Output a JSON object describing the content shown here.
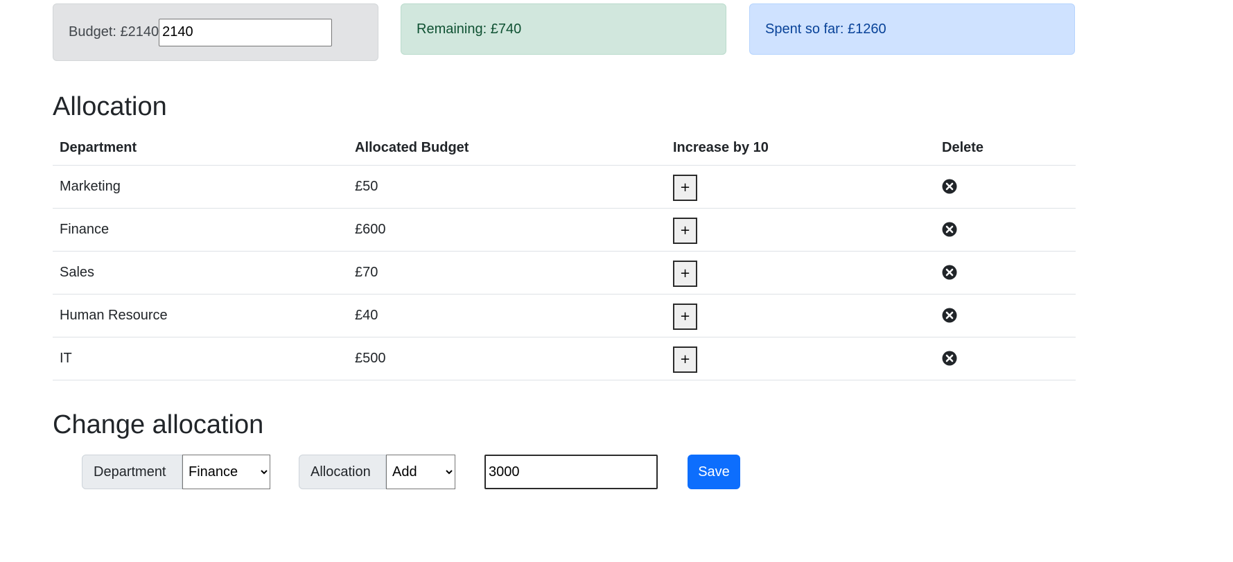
{
  "cards": {
    "budget_label": "Budget: £2140",
    "budget_value": "2140",
    "remaining": "Remaining: £740",
    "spent": "Spent so far: £1260"
  },
  "allocation": {
    "heading": "Allocation",
    "columns": [
      "Department",
      "Allocated Budget",
      "Increase by 10",
      "Delete"
    ],
    "rows": [
      {
        "department": "Marketing",
        "budget": "£50",
        "increase_label": "+"
      },
      {
        "department": "Finance",
        "budget": "£600",
        "increase_label": "+"
      },
      {
        "department": "Sales",
        "budget": "£70",
        "increase_label": "+"
      },
      {
        "department": "Human Resource",
        "budget": "£40",
        "increase_label": "+"
      },
      {
        "department": "IT",
        "budget": "£500",
        "increase_label": "+"
      }
    ]
  },
  "change": {
    "heading": "Change allocation",
    "department_label": "Department",
    "department_selected": "Finance",
    "allocation_label": "Allocation",
    "allocation_selected": "Add",
    "amount_value": "3000",
    "save_label": "Save"
  },
  "icons": {
    "delete": "circle-x-icon"
  }
}
